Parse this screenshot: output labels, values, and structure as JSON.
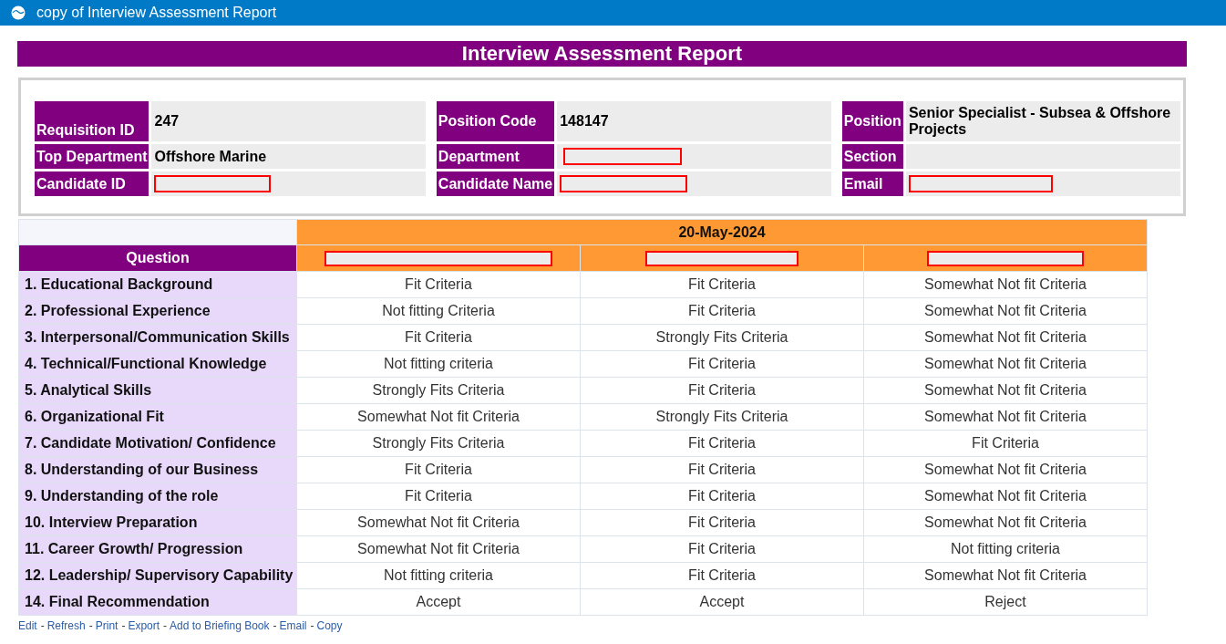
{
  "app_bar": {
    "title": "copy of Interview Assessment Report"
  },
  "report_title": "Interview Assessment Report",
  "details": [
    [
      {
        "label": "Requisition ID",
        "value": "247"
      },
      {
        "label": "Position Code",
        "value": "148147"
      },
      {
        "label": "Position",
        "value": "Senior Specialist - Subsea & Offshore Projects"
      }
    ],
    [
      {
        "label": "Top Department",
        "value": "Offshore Marine"
      },
      {
        "label": "Department",
        "redacted": true
      },
      {
        "label": "Section"
      }
    ],
    [
      {
        "label": "Candidate ID",
        "redacted": true
      },
      {
        "label": "Candidate Name",
        "redacted": true
      },
      {
        "label": "Email",
        "redacted": true
      }
    ]
  ],
  "assessment": {
    "date": "20-May-2024",
    "question_header": "Question",
    "interviewers": [
      {
        "redacted": true
      },
      {
        "redacted": true
      },
      {
        "redacted": true
      }
    ],
    "rows": [
      {
        "question": "1. Educational Background",
        "ratings": [
          "Fit Criteria",
          "Fit Criteria",
          "Somewhat Not fit Criteria"
        ]
      },
      {
        "question": "2. Professional Experience",
        "ratings": [
          "Not fitting Criteria",
          "Fit Criteria",
          "Somewhat Not fit Criteria"
        ]
      },
      {
        "question": "3. Interpersonal/Communication Skills",
        "ratings": [
          "Fit Criteria",
          "Strongly Fits Criteria",
          "Somewhat Not fit Criteria"
        ]
      },
      {
        "question": "4. Technical/Functional Knowledge",
        "ratings": [
          "Not fitting criteria",
          "Fit Criteria",
          "Somewhat Not fit Criteria"
        ]
      },
      {
        "question": "5. Analytical Skills",
        "ratings": [
          "Strongly Fits Criteria",
          "Fit Criteria",
          "Somewhat Not fit Criteria"
        ]
      },
      {
        "question": "6. Organizational Fit",
        "ratings": [
          "Somewhat Not fit Criteria",
          "Strongly Fits Criteria",
          "Somewhat Not fit Criteria"
        ]
      },
      {
        "question": "7. Candidate Motivation/ Confidence",
        "ratings": [
          "Strongly Fits Criteria",
          "Fit Criteria",
          "Fit Criteria"
        ]
      },
      {
        "question": "8. Understanding of our Business",
        "ratings": [
          "Fit Criteria",
          "Fit Criteria",
          "Somewhat Not fit Criteria"
        ]
      },
      {
        "question": "9. Understanding of the role",
        "ratings": [
          "Fit Criteria",
          "Fit Criteria",
          "Somewhat Not fit Criteria"
        ]
      },
      {
        "question": "10. Interview Preparation",
        "ratings": [
          "Somewhat Not fit Criteria",
          "Fit Criteria",
          "Somewhat Not fit Criteria"
        ]
      },
      {
        "question": "11. Career Growth/ Progression",
        "ratings": [
          "Somewhat Not fit Criteria",
          "Fit Criteria",
          "Not fitting criteria"
        ]
      },
      {
        "question": "12. Leadership/ Supervisory Capability",
        "ratings": [
          "Not fitting criteria",
          "Fit Criteria",
          "Somewhat Not fit Criteria"
        ]
      },
      {
        "question": "14. Final Recommendation",
        "ratings": [
          "Accept",
          "Accept",
          "Reject"
        ]
      }
    ]
  },
  "footer_links": [
    {
      "label": "Edit"
    },
    {
      "separator": "-",
      "label": "Refresh"
    },
    {
      "separator": "-",
      "label": "Print"
    },
    {
      "separator": "-",
      "label": "Export"
    },
    {
      "separator": "-",
      "label": "Add to Briefing Book"
    },
    {
      "separator": "-",
      "label": "Email"
    },
    {
      "separator": "-",
      "label": "Copy"
    }
  ]
}
